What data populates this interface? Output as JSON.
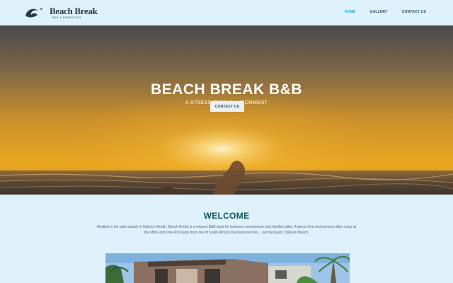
{
  "logo": {
    "title": "Beach Break",
    "subtitle": "B&B & BREAKFAST"
  },
  "nav": {
    "home": "HOME",
    "gallery": "GALLERY",
    "contact": "CONTACT US"
  },
  "hero": {
    "title": "BEACH BREAK B&B",
    "subtitle": "A STRESS FREE ENVIRONMENT",
    "button": "CONTACT US"
  },
  "welcome": {
    "title": "WELCOME",
    "text": "Nestled in the safe suburb of Nahoon Mouth, Beach Break is a relaxed B&B ideal for business men/women and families alike. A stress free environment after a day at the office and only 400 steps from one of South Africa's best kept secrets... our backyard, Nahoon Beach."
  },
  "colors": {
    "background": "#dff1fb",
    "nav_active": "#2aa7c9",
    "nav": "#1f4e5f",
    "heading": "#0e5a5e"
  }
}
